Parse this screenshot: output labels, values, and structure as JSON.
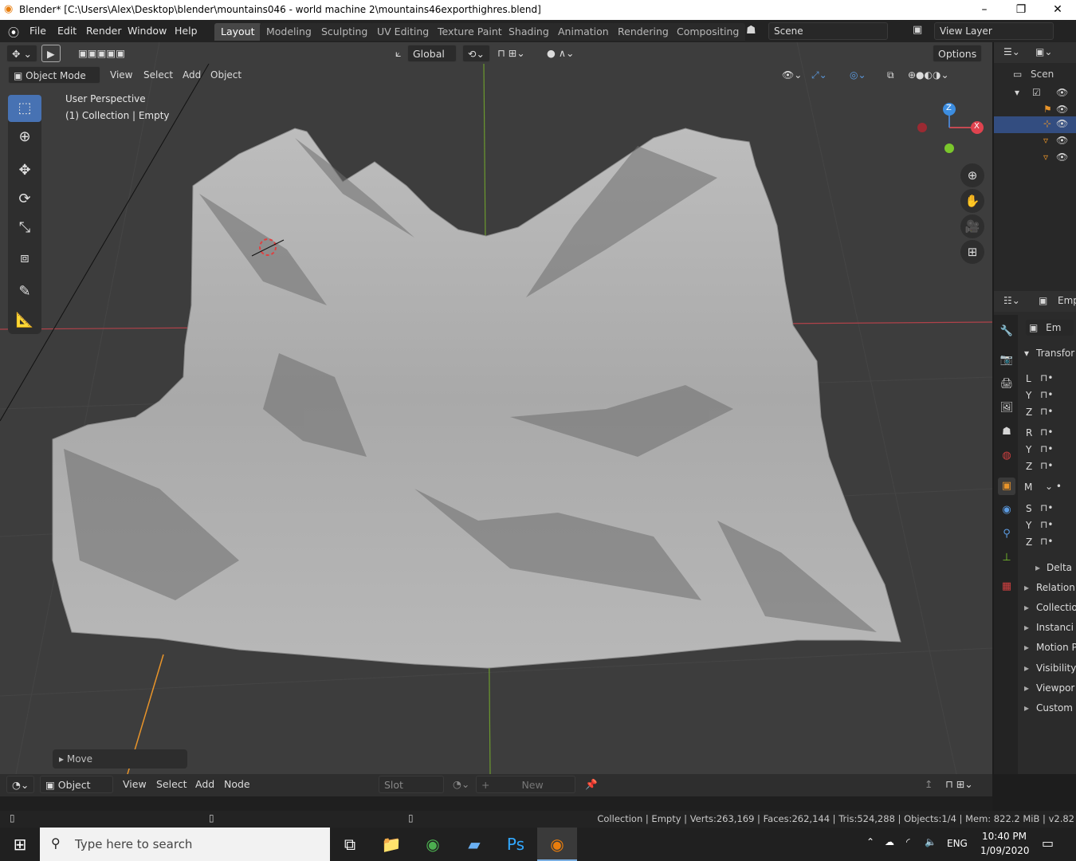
{
  "window": {
    "title": "Blender* [C:\\Users\\Alex\\Desktop\\blender\\mountains046 - world machine 2\\mountains46exporthighres.blend]",
    "min": "–",
    "max": "❐",
    "close": "✕"
  },
  "menu": [
    "File",
    "Edit",
    "Render",
    "Window",
    "Help"
  ],
  "workspaces": [
    "Layout",
    "Modeling",
    "Sculpting",
    "UV Editing",
    "Texture Paint",
    "Shading",
    "Animation",
    "Rendering",
    "Compositing"
  ],
  "scene": {
    "name": "Scene",
    "view_layer": "View Layer"
  },
  "tool_header": {
    "orientation": "Global",
    "options": "Options"
  },
  "viewport_header": {
    "mode": "Object Mode",
    "menus": [
      "View",
      "Select",
      "Add",
      "Object"
    ]
  },
  "overlay": {
    "line1": "User Perspective",
    "line2": "(1) Collection | Empty"
  },
  "gizmo": {
    "x": "X",
    "z": "Z"
  },
  "last_op": "Move",
  "outliner": {
    "root": "Scen"
  },
  "properties": {
    "header": "Emp",
    "object_name": "Em",
    "transform_label": "Transfor",
    "rows": [
      "L",
      "Y",
      "Z",
      "R",
      "Y",
      "Z",
      "M",
      "S",
      "Y",
      "Z"
    ],
    "sections": [
      "Delta",
      "Relation",
      "Collectio",
      "Instanci",
      "Motion P",
      "Visibility",
      "Viewpor",
      "Custom"
    ]
  },
  "shader_header": {
    "type": "Object",
    "menus": [
      "View",
      "Select",
      "Add",
      "Node"
    ],
    "slot": "Slot",
    "new": "New"
  },
  "status": "Collection | Empty | Verts:263,169 | Faces:262,144 | Tris:524,288 | Objects:1/4 | Mem: 822.2 MiB | v2.82",
  "taskbar": {
    "search": "Type here to search",
    "lang": "ENG",
    "time": "10:40 PM",
    "date": "1/09/2020"
  }
}
